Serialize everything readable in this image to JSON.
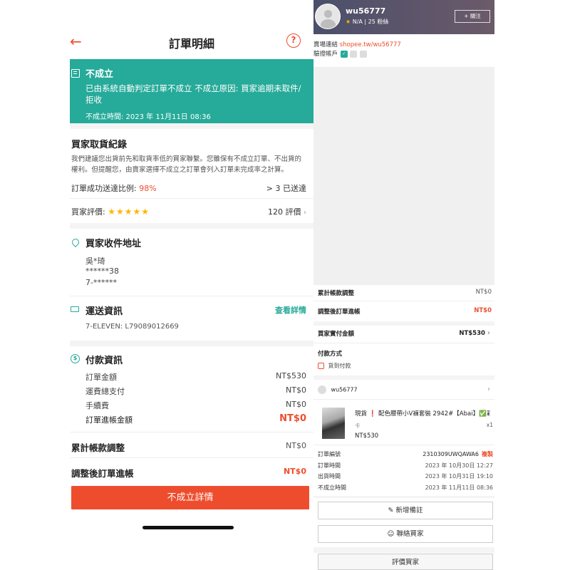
{
  "left": {
    "header": {
      "back_icon": "arrow-left-icon",
      "title": "訂單明細",
      "help_label": "?"
    },
    "status": {
      "title": "不成立",
      "description": "已由系統自動判定訂單不成立 不成立原因: 買家逾期未取件/拒收",
      "time": "不成立時間: 2023 年 11月11日 08:36"
    },
    "buyer_record": {
      "title": "買家取貨紀錄",
      "note": "我們建議您出貨前先和取貨率低的買家聯繫。您雖保有不成立訂單、不出貨的權利。但提醒您，由賣家選擇不成立之訂單會列入訂單未完成率之計算。",
      "success_label": "訂單成功送達比例:",
      "success_value": "98%",
      "delivered": "> 3 已送達",
      "rating_label": "買家評價:",
      "stars": "★★★★★",
      "rating_count": "120 評價",
      "chevron": "›"
    },
    "address": {
      "title": "買家收件地址",
      "name": "吳*琦",
      "phone": "******38",
      "store": "7-******"
    },
    "shipping": {
      "title": "運送資訊",
      "detail_link": "查看詳情",
      "tracking": "7-ELEVEN: L79089012669"
    },
    "payment": {
      "title": "付款資訊",
      "rows": [
        {
          "label": "訂單金額",
          "value": "NT$530"
        },
        {
          "label": "運費總支付",
          "value": "NT$0"
        },
        {
          "label": "手續費",
          "value": "NT$0"
        }
      ],
      "income_label": "訂單進帳金額",
      "income_value": "NT$0"
    },
    "adjust": {
      "label": "累計帳款調整",
      "value": "NT$0"
    },
    "adjusted": {
      "label": "調整後訂單進帳",
      "value": "NT$0"
    },
    "cta_label": "不成立詳情"
  },
  "right": {
    "user": {
      "name": "wu56777",
      "rating": "N/A",
      "followers": "25 粉絲",
      "follow_label": "+ 關注"
    },
    "shop_link_label": "賣場連結",
    "shop_link": "shopee.tw/wu56777",
    "verify_label": "驗證帳戶",
    "adjust": {
      "label": "累計帳款調整",
      "value": "NT$0"
    },
    "adjusted": {
      "label": "調整後訂單進帳",
      "value": "NT$0"
    },
    "paid": {
      "label": "買家實付金額",
      "value": "NT$530"
    },
    "pay_method": {
      "title": "付款方式",
      "value": "貨到付款"
    },
    "seller": "wu56777",
    "product": {
      "prefix": "現貨",
      "mark": "❗",
      "title": "配色腰帶小V褲套裝 2942#【Abai】✅彩...",
      "variant": "卡",
      "qty": "x1",
      "price": "NT$530"
    },
    "meta": [
      {
        "label": "訂單編號",
        "value": "2310309UWQAWA6"
      },
      {
        "label": "訂單時間",
        "value": "2023 年 10月30日 12:27"
      },
      {
        "label": "出貨時間",
        "value": "2023 年 10月31日 19:10"
      },
      {
        "label": "不成立時間",
        "value": "2023 年 11月11日 08:36"
      }
    ],
    "copy_label": "複製",
    "buttons": {
      "note": "新增備註",
      "contact": "聯絡買家",
      "rate": "評價買家"
    }
  }
}
